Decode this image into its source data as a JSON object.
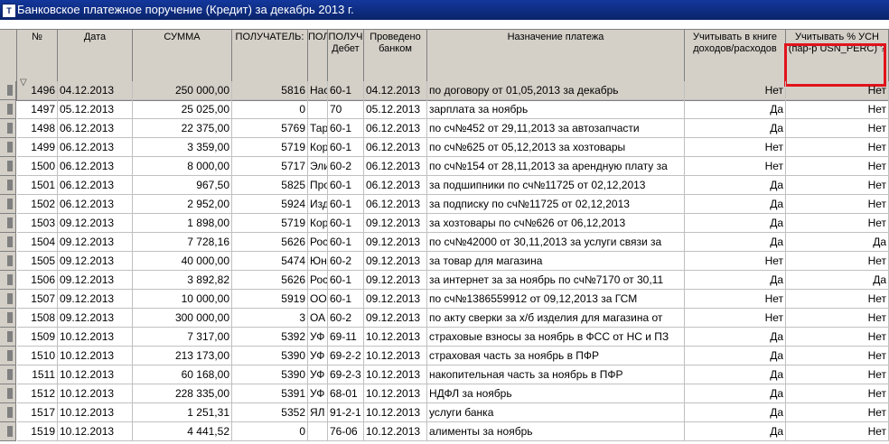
{
  "window": {
    "title": "Банковское платежное поручение (Кредит) за декабрь 2013 г.",
    "icon": "app-icon"
  },
  "columns": {
    "num": "№",
    "date": "Дата",
    "sum": "СУММА",
    "recipient": "ПОЛУЧАТЕЛЬ:",
    "po": "ПОЛ",
    "debit_top": "ПОЛУЧ",
    "debit_bottom": "Дебет",
    "bank_top": "Проведено",
    "bank_bottom": "банком",
    "purpose": "Назначение платежа",
    "book_top": "Учитывать в книге",
    "book_bottom": "доходов/расходов",
    "usn_top": "Учитывать % УСН",
    "usn_bottom": "(пар-р USN_PERC) ?"
  },
  "rows": [
    {
      "n": "1496",
      "date": "04.12.2013",
      "sum": "250 000,00",
      "rec": "5816",
      "po": "Нас",
      "deb": "60-1",
      "bank": "04.12.2013",
      "purpose": "по договору от 01,05,2013 за декабрь",
      "book": "Нет",
      "usn": "Нет"
    },
    {
      "n": "1497",
      "date": "05.12.2013",
      "sum": "25 025,00",
      "rec": "0",
      "po": "",
      "deb": "70",
      "bank": "05.12.2013",
      "purpose": "зарплата за ноябрь",
      "book": "Да",
      "usn": "Нет"
    },
    {
      "n": "1498",
      "date": "06.12.2013",
      "sum": "22 375,00",
      "rec": "5769",
      "po": "Тар",
      "deb": "60-1",
      "bank": "06.12.2013",
      "purpose": "по сч№452 от 29,11,2013 за автозапчасти",
      "book": "Да",
      "usn": "Нет"
    },
    {
      "n": "1499",
      "date": "06.12.2013",
      "sum": "3 359,00",
      "rec": "5719",
      "po": "Кор",
      "deb": "60-1",
      "bank": "06.12.2013",
      "purpose": "по сч№625 от 05,12,2013 за хозтовары",
      "book": "Нет",
      "usn": "Нет"
    },
    {
      "n": "1500",
      "date": "06.12.2013",
      "sum": "8 000,00",
      "rec": "5717",
      "po": "Эли",
      "deb": "60-2",
      "bank": "06.12.2013",
      "purpose": "по сч№154 от 28,11,2013 за арендную плату за",
      "book": "Нет",
      "usn": "Нет"
    },
    {
      "n": "1501",
      "date": "06.12.2013",
      "sum": "967,50",
      "rec": "5825",
      "po": "Про",
      "deb": "60-1",
      "bank": "06.12.2013",
      "purpose": "за подшипники по сч№11725 от 02,12,2013",
      "book": "Да",
      "usn": "Нет"
    },
    {
      "n": "1502",
      "date": "06.12.2013",
      "sum": "2 952,00",
      "rec": "5924",
      "po": "Изд",
      "deb": "60-1",
      "bank": "06.12.2013",
      "purpose": "за подписку по сч№11725 от 02,12,2013",
      "book": "Да",
      "usn": "Нет"
    },
    {
      "n": "1503",
      "date": "09.12.2013",
      "sum": "1 898,00",
      "rec": "5719",
      "po": "Кор",
      "deb": "60-1",
      "bank": "09.12.2013",
      "purpose": "за хозтовары по сч№626 от 06,12,2013",
      "book": "Да",
      "usn": "Нет"
    },
    {
      "n": "1504",
      "date": "09.12.2013",
      "sum": "7 728,16",
      "rec": "5626",
      "po": "Рос",
      "deb": "60-1",
      "bank": "09.12.2013",
      "purpose": "по сч№42000 от 30,11,2013 за услуги связи за",
      "book": "Да",
      "usn": "Да"
    },
    {
      "n": "1505",
      "date": "09.12.2013",
      "sum": "40 000,00",
      "rec": "5474",
      "po": "Юн",
      "deb": "60-2",
      "bank": "09.12.2013",
      "purpose": "за товар для магазина",
      "book": "Нет",
      "usn": "Нет"
    },
    {
      "n": "1506",
      "date": "09.12.2013",
      "sum": "3 892,82",
      "rec": "5626",
      "po": "Рос",
      "deb": "60-1",
      "bank": "09.12.2013",
      "purpose": "за интернет за за ноябрь по сч№7170 от 30,11",
      "book": "Да",
      "usn": "Да"
    },
    {
      "n": "1507",
      "date": "09.12.2013",
      "sum": "10 000,00",
      "rec": "5919",
      "po": "ОО",
      "deb": "60-1",
      "bank": "09.12.2013",
      "purpose": "по сч№1386559912 от 09,12,2013 за ГСМ",
      "book": "Нет",
      "usn": "Нет"
    },
    {
      "n": "1508",
      "date": "09.12.2013",
      "sum": "300 000,00",
      "rec": "3",
      "po": "ОА",
      "deb": "60-2",
      "bank": "09.12.2013",
      "purpose": "по акту сверки за х/б изделия для магазина от",
      "book": "Нет",
      "usn": "Нет"
    },
    {
      "n": "1509",
      "date": "10.12.2013",
      "sum": "7 317,00",
      "rec": "5392",
      "po": "УФ",
      "deb": "69-11",
      "bank": "10.12.2013",
      "purpose": "страховые взносы за ноябрь в ФСС от НС и ПЗ",
      "book": "Да",
      "usn": "Нет"
    },
    {
      "n": "1510",
      "date": "10.12.2013",
      "sum": "213 173,00",
      "rec": "5390",
      "po": "УФ",
      "deb": "69-2-2",
      "bank": "10.12.2013",
      "purpose": "страховая часть за ноябрь в ПФР",
      "book": "Да",
      "usn": "Нет"
    },
    {
      "n": "1511",
      "date": "10.12.2013",
      "sum": "60 168,00",
      "rec": "5390",
      "po": "УФ",
      "deb": "69-2-3",
      "bank": "10.12.2013",
      "purpose": "накопительная часть за ноябрь в ПФР",
      "book": "Да",
      "usn": "Нет"
    },
    {
      "n": "1512",
      "date": "10.12.2013",
      "sum": "228 335,00",
      "rec": "5391",
      "po": "УФ",
      "deb": "68-01",
      "bank": "10.12.2013",
      "purpose": "НДФЛ за ноябрь",
      "book": "Да",
      "usn": "Нет"
    },
    {
      "n": "1517",
      "date": "10.12.2013",
      "sum": "1 251,31",
      "rec": "5352",
      "po": "ЯЛ",
      "deb": "91-2-1",
      "bank": "10.12.2013",
      "purpose": "услуги банка",
      "book": "Да",
      "usn": "Нет"
    },
    {
      "n": "1519",
      "date": "10.12.2013",
      "sum": "4 441,52",
      "rec": "0",
      "po": "",
      "deb": "76-06",
      "bank": "10.12.2013",
      "purpose": "алименты за ноябрь",
      "book": "Да",
      "usn": "Нет"
    }
  ]
}
